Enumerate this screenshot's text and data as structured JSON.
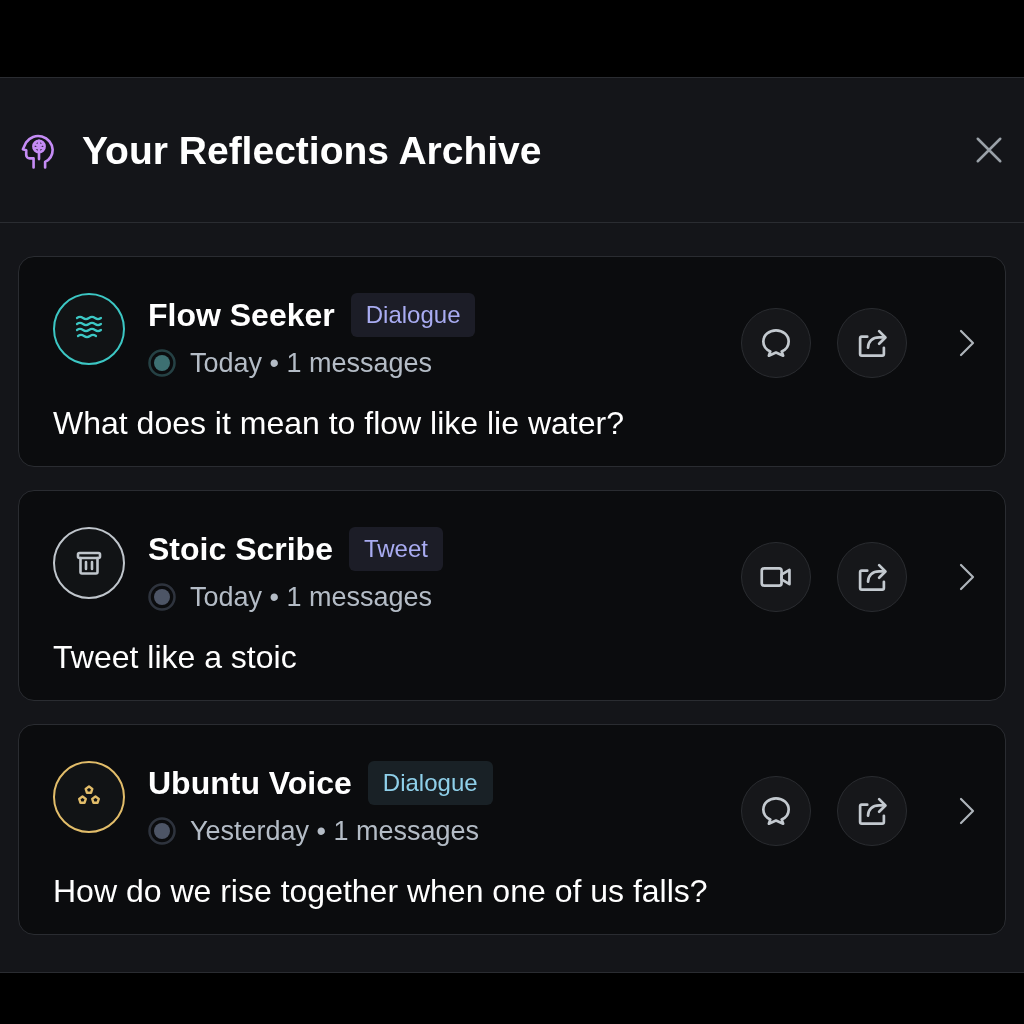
{
  "header": {
    "title": "Your Reflections Archive"
  },
  "cards": [
    {
      "name": "Flow Seeker",
      "tag": {
        "label": "Dialogue",
        "color": "#a9acf2"
      },
      "avatar": {
        "kind": "waves",
        "color": "#3cc7c4"
      },
      "status": {
        "color": "#3d7072"
      },
      "meta": "Today • 1 messages",
      "question": "What does it mean to flow like lie water?",
      "actions": [
        {
          "kind": "comment"
        },
        {
          "kind": "share"
        }
      ]
    },
    {
      "name": "Stoic Scribe",
      "tag": {
        "label": "Tweet",
        "color": "#a9acf2"
      },
      "avatar": {
        "kind": "bin",
        "color": "#c0c6cc"
      },
      "status": {
        "color": "#4d5566"
      },
      "meta": "Today • 1 messages",
      "question": "Tweet like a stoic",
      "actions": [
        {
          "kind": "video"
        },
        {
          "kind": "share"
        }
      ]
    },
    {
      "name": "Ubuntu Voice",
      "tag": {
        "label": "Dialogue",
        "color": "#8fd0ea"
      },
      "avatar": {
        "kind": "hexagons",
        "color": "#e2bd6a"
      },
      "status": {
        "color": "#4d5566"
      },
      "meta": "Yesterday • 1 messages",
      "question": "How do we rise together when one of us falls?",
      "actions": [
        {
          "kind": "comment"
        },
        {
          "kind": "share"
        }
      ]
    }
  ]
}
